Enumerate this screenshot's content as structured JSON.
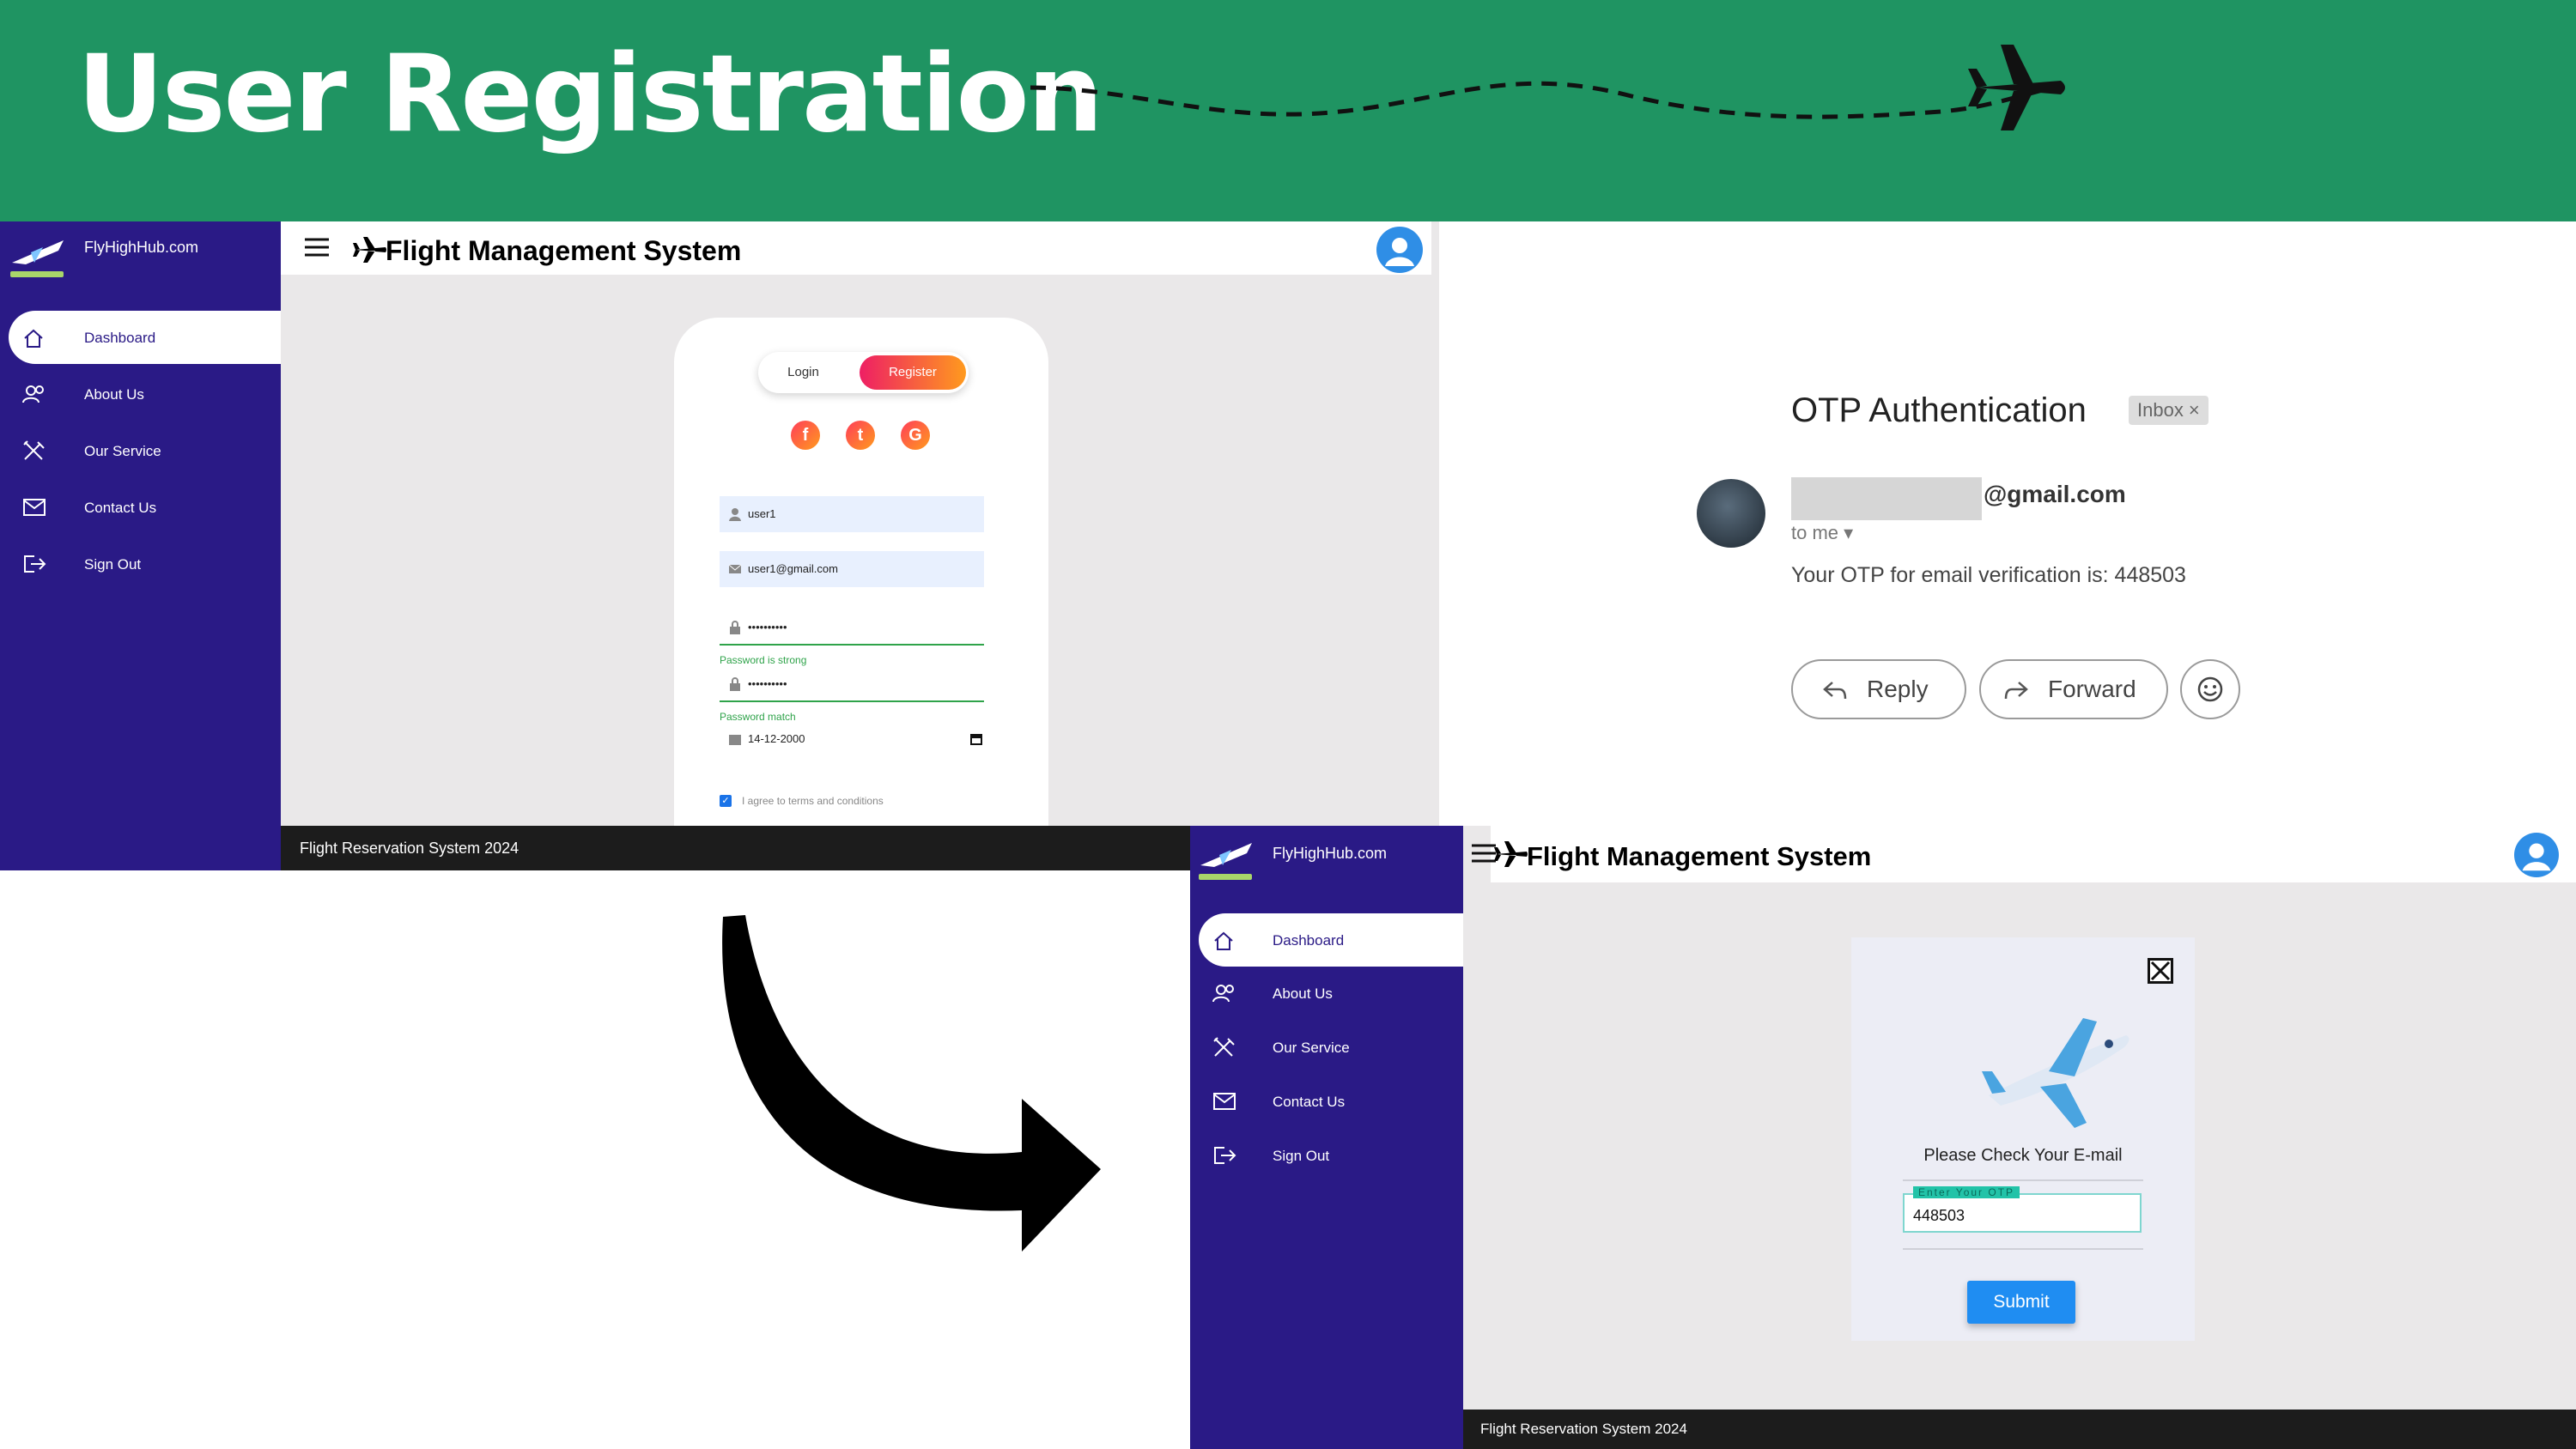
{
  "banner": {
    "title": "User Registration"
  },
  "brand": {
    "site": "FlyHighHub.com",
    "app_title": "Flight Management System",
    "footer": "Flight Reservation System 2024"
  },
  "sidebar": {
    "items": [
      {
        "label": "Dashboard",
        "icon": "home-icon"
      },
      {
        "label": "About Us",
        "icon": "users-icon"
      },
      {
        "label": "Our Service",
        "icon": "tools-icon"
      },
      {
        "label": "Contact Us",
        "icon": "mail-icon"
      },
      {
        "label": "Sign Out",
        "icon": "sign-out-icon"
      }
    ]
  },
  "register": {
    "tab_login": "Login",
    "tab_register": "Register",
    "social": [
      "f",
      "t",
      "G"
    ],
    "username": "user1",
    "email": "user1@gmail.com",
    "password": "••••••••••",
    "password_hint": "Password is strong",
    "confirm": "••••••••••",
    "confirm_hint": "Password match",
    "dob": "14-12-2000",
    "terms": "I agree to terms and conditions"
  },
  "email": {
    "subject": "OTP Authentication",
    "badge": "Inbox ×",
    "sender_domain": "@gmail.com",
    "to": "to me ▾",
    "body": "Your OTP for email verification is: 448503",
    "reply": "Reply",
    "forward": "Forward"
  },
  "otp": {
    "message": "Please Check Your E-mail",
    "float_label": "Enter Your OTP",
    "value": "448503",
    "submit": "Submit"
  },
  "colors": {
    "banner": "#1f9462",
    "sidebar": "#2a1a86",
    "accent": "#1f8df2"
  }
}
